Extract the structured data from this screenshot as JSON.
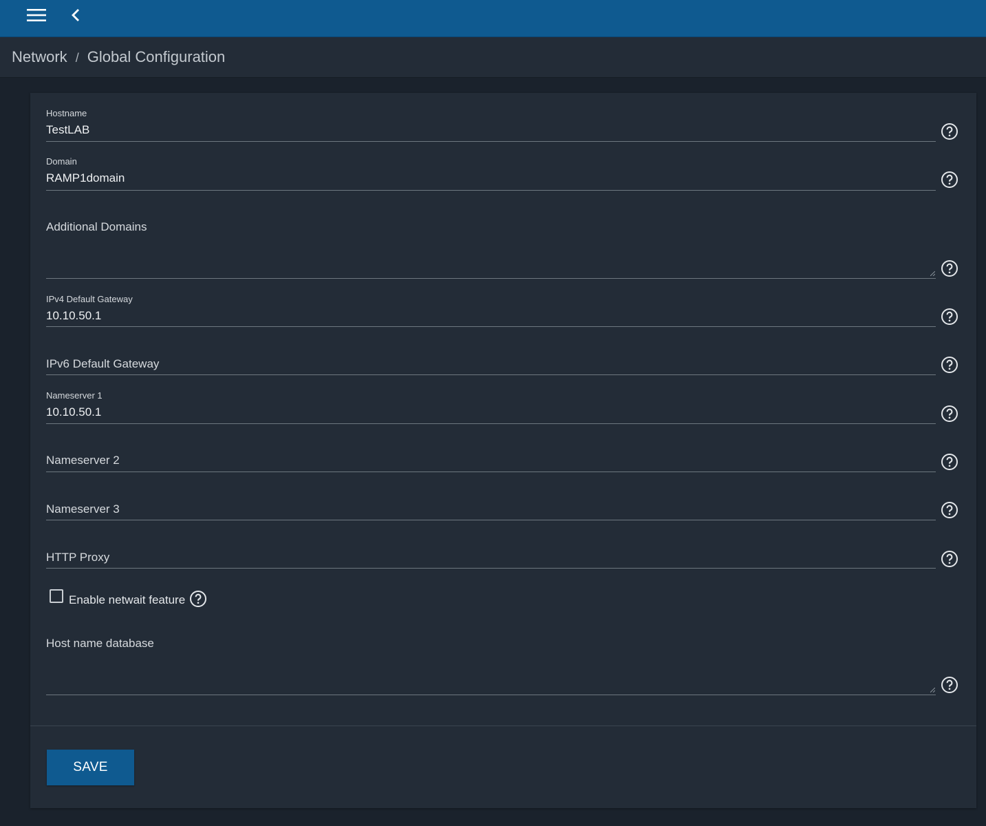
{
  "topbar": {
    "menu_icon": "hamburger-menu-icon",
    "back_icon": "chevron-left-icon",
    "accent_color": "#0f5a90"
  },
  "breadcrumb": {
    "parent": "Network",
    "separator": "/",
    "current": "Global Configuration"
  },
  "form": {
    "hostname": {
      "label": "Hostname",
      "value": "TestLAB"
    },
    "domain": {
      "label": "Domain",
      "value": "RAMP1domain"
    },
    "additional_domains": {
      "label": "Additional Domains",
      "value": ""
    },
    "ipv4_gateway": {
      "label": "IPv4 Default Gateway",
      "value": "10.10.50.1"
    },
    "ipv6_gateway": {
      "label": "IPv6 Default Gateway",
      "value": ""
    },
    "nameserver1": {
      "label": "Nameserver 1",
      "value": "10.10.50.1"
    },
    "nameserver2": {
      "label": "Nameserver 2",
      "value": ""
    },
    "nameserver3": {
      "label": "Nameserver 3",
      "value": ""
    },
    "http_proxy": {
      "label": "HTTP Proxy",
      "value": ""
    },
    "netwait": {
      "label": "Enable netwait feature",
      "checked": false
    },
    "hosts_db": {
      "label": "Host name database",
      "value": ""
    },
    "help_icon": "help-circle-icon"
  },
  "actions": {
    "save_label": "SAVE"
  }
}
